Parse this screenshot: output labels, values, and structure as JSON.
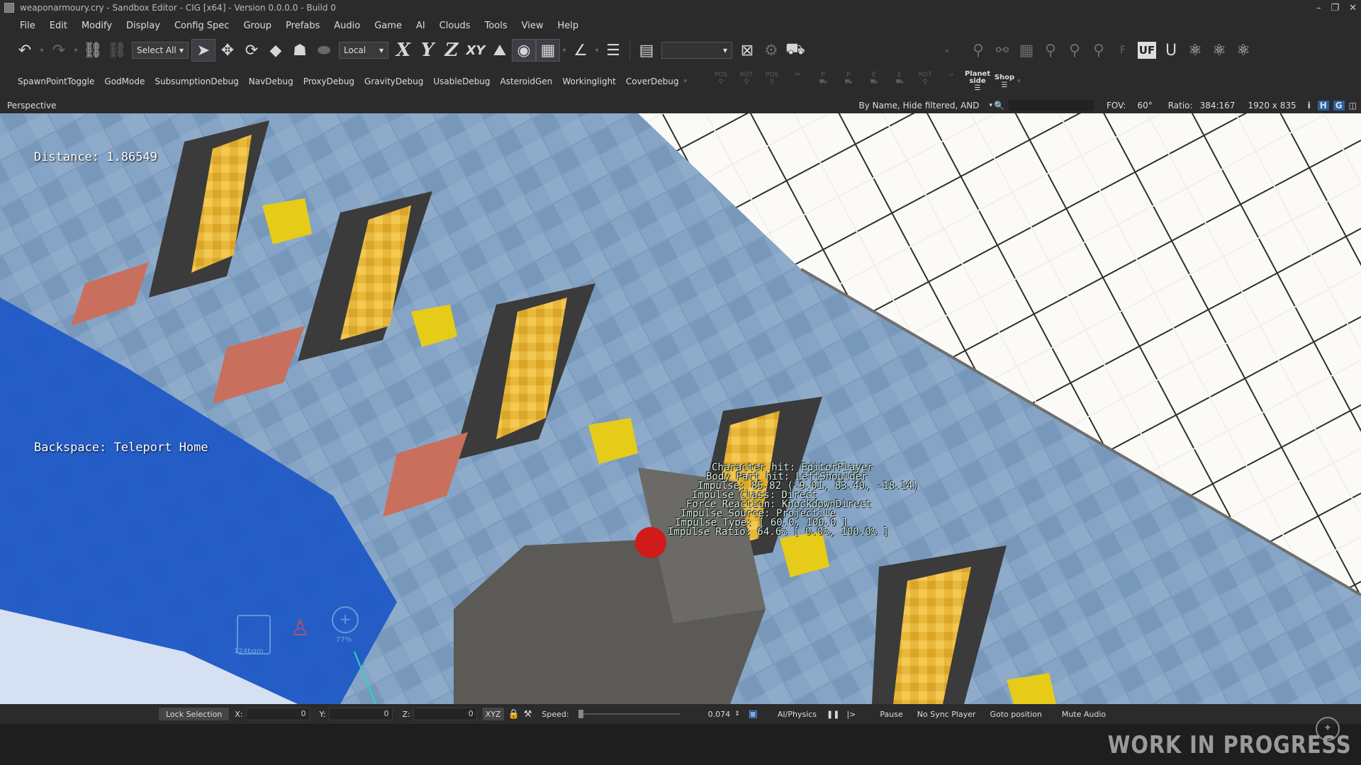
{
  "window": {
    "title": "weaponarmoury.cry - Sandbox Editor - CIG [x64] - Version 0.0.0.0 - Build 0"
  },
  "menu": [
    "File",
    "Edit",
    "Modify",
    "Display",
    "Config Spec",
    "Group",
    "Prefabs",
    "Audio",
    "Game",
    "AI",
    "Clouds",
    "Tools",
    "View",
    "Help"
  ],
  "toolbar": {
    "select_all": "Select All",
    "coord_space": "Local",
    "axis_x": "X",
    "axis_y": "Y",
    "axis_z": "Z",
    "axis_xy": "XY",
    "uf_label": "UF",
    "f_label": "F"
  },
  "debug_toolbar": [
    "SpawnPointToggle",
    "GodMode",
    "SubsumptionDebug",
    "NavDebug",
    "ProxyDebug",
    "GravityDebug",
    "UsableDebug",
    "AsteroidGen",
    "Workinglight",
    "CoverDebug"
  ],
  "ghost_tools": [
    "POS",
    "ROT",
    "POS",
    "",
    "P",
    "P",
    "E",
    "E",
    "ROT",
    ""
  ],
  "planetside": {
    "line1": "Planet",
    "line2": "side"
  },
  "shop": "Shop",
  "viewport_bar": {
    "mode": "Perspective",
    "filter": "By Name, Hide filtered, AND",
    "fov_label": "FOV:",
    "fov_value": "60°",
    "ratio_label": "Ratio:",
    "ratio_value": "384:167",
    "resolution": "1920 x 835"
  },
  "hud": {
    "distance": "Distance: 1.86549",
    "teleport": "Backspace: Teleport Home",
    "ammo": "124bgm",
    "health": "77%"
  },
  "hit_debug": [
    "Character hit: EditorPlayer",
    "Body Part hit: LeftShoulder",
    "Impulse: 85.82 (-9.01, 83.40, -18.14)",
    "Impulse Class: Direct",
    "Force Reaction: KnockdownDirect",
    "Impulse Source: Projectile",
    "Impulse Type: [ 60.0, 100.0 ]",
    "Impulse Ratio: 64.6% [ 0.0%, 100.0% ]"
  ],
  "statusbar": {
    "lock_selection": "Lock Selection",
    "x_label": "X:",
    "x_value": "0",
    "y_label": "Y:",
    "y_value": "0",
    "z_label": "Z:",
    "z_value": "0",
    "xyz": "XYZ",
    "speed_label": "Speed:",
    "speed_value": "0.074",
    "ai_physics": "AI/Physics",
    "pause": "Pause",
    "no_sync": "No Sync Player",
    "goto": "Goto position",
    "mute": "Mute Audio"
  },
  "watermark": "WORK IN PROGRESS",
  "colors": {
    "ui_bg": "#2b2b2b",
    "floor": "#7c9bbd",
    "target_yellow": "#e8b83a",
    "hit_text": "#d8f5e8"
  }
}
